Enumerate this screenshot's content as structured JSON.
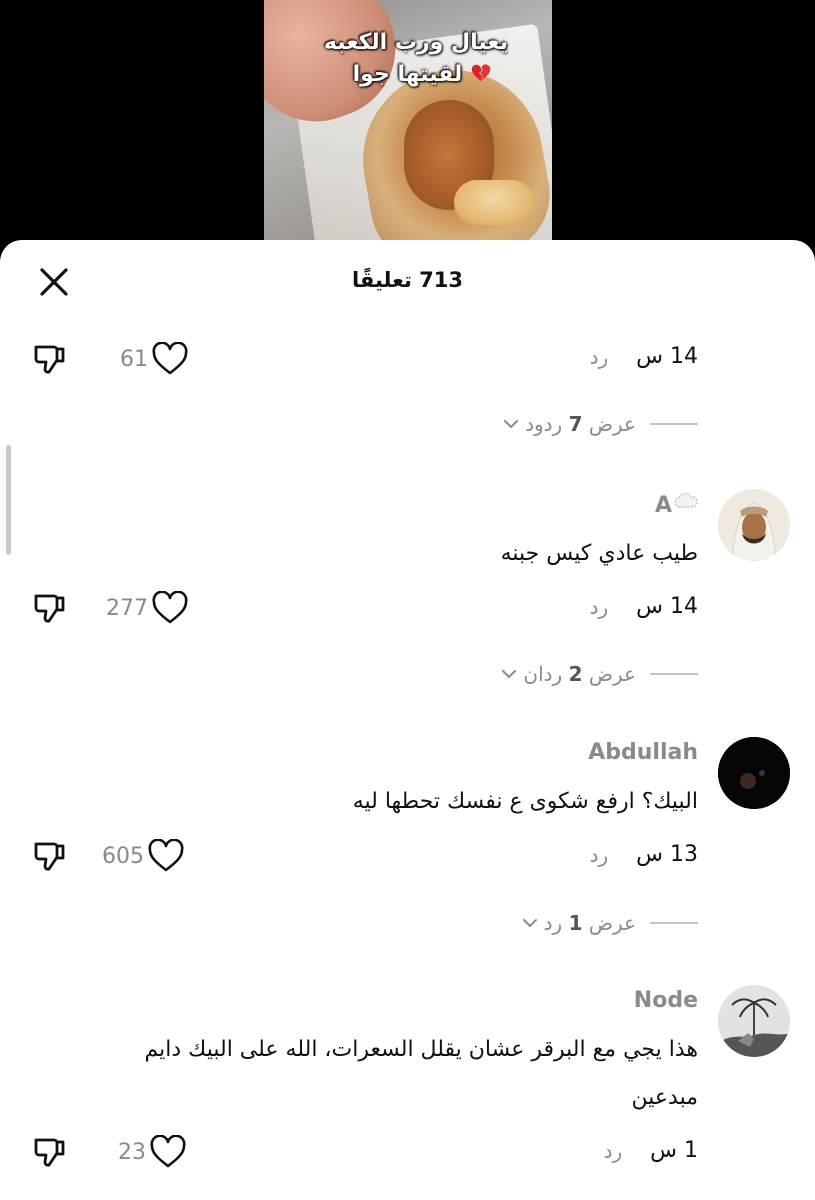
{
  "video": {
    "caption_line1": "يعيال ورب الكعبه",
    "caption_line2": "لقيتها جوا"
  },
  "sheet": {
    "title": "713 تعليقًا"
  },
  "comments": [
    {
      "time": "14 س",
      "reply": "رد",
      "likes": "61",
      "view_replies_prefix": "عرض",
      "view_replies_count": "7",
      "view_replies_suffix": "ردود"
    },
    {
      "author": "A",
      "text": "طيب عادي كيس جبنه",
      "time": "14 س",
      "reply": "رد",
      "likes": "277",
      "view_replies_prefix": "عرض",
      "view_replies_count": "2",
      "view_replies_suffix": "ردان"
    },
    {
      "author": "Abdullah",
      "text": "البيك؟ ارفع شكوى ع نفسك تحطها ليه",
      "time": "13 س",
      "reply": "رد",
      "likes": "605",
      "view_replies_prefix": "عرض",
      "view_replies_count": "1",
      "view_replies_suffix": "رد"
    },
    {
      "author": "Node",
      "text_line1": "هذا يجي مع البرقر عشان يقلل السعرات، الله على البيك دايم",
      "text_line2": "مبدعين",
      "time": "1 س",
      "reply": "رد",
      "likes": "23"
    }
  ],
  "icons": {
    "close": "close-icon",
    "like": "heart-outline-icon",
    "dislike": "thumbs-down-icon",
    "chevron": "chevron-down-icon",
    "broken_heart": "broken-heart-icon"
  },
  "colors": {
    "muted": "#8a8a8a",
    "text": "#111111",
    "sheet_bg": "#ffffff",
    "backdrop": "#000000"
  }
}
